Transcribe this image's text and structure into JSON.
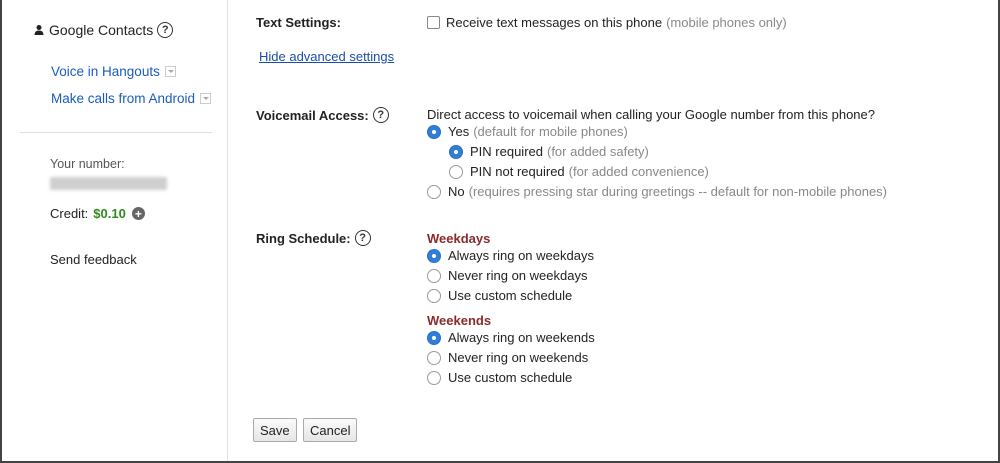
{
  "sidebar": {
    "contacts_label": "Google Contacts",
    "help_glyph": "?",
    "links": [
      {
        "label": "Voice in Hangouts"
      },
      {
        "label": "Make calls from Android"
      }
    ],
    "your_number_label": "Your number:",
    "credit_label": "Credit:",
    "credit_value": "$0.10",
    "plus_glyph": "+",
    "feedback_label": "Send feedback"
  },
  "text_settings": {
    "label": "Text Settings:",
    "checkbox_label": "Receive text messages on this phone",
    "checkbox_hint": "(mobile phones only)",
    "advanced_link": "Hide advanced settings"
  },
  "voicemail": {
    "label": "Voicemail Access:",
    "question": "Direct access to voicemail when calling your Google number from this phone?",
    "yes_label": "Yes",
    "yes_hint": "(default for mobile phones)",
    "pin_required_label": "PIN required",
    "pin_required_hint": "(for added safety)",
    "pin_not_required_label": "PIN not required",
    "pin_not_required_hint": "(for added convenience)",
    "no_label": "No",
    "no_hint": "(requires pressing star during greetings -- default for non-mobile phones)"
  },
  "ring": {
    "label": "Ring Schedule:",
    "weekdays_heading": "Weekdays",
    "weekdays_options": [
      "Always ring on weekdays",
      "Never ring on weekdays",
      "Use custom schedule"
    ],
    "weekends_heading": "Weekends",
    "weekends_options": [
      "Always ring on weekends",
      "Never ring on weekends",
      "Use custom schedule"
    ]
  },
  "buttons": {
    "save": "Save",
    "cancel": "Cancel"
  },
  "colors": {
    "link": "#1a5bbf",
    "credit": "#2e8b1e",
    "subheading": "#8b2a2a",
    "radio_selected": "#2f7fd8"
  }
}
